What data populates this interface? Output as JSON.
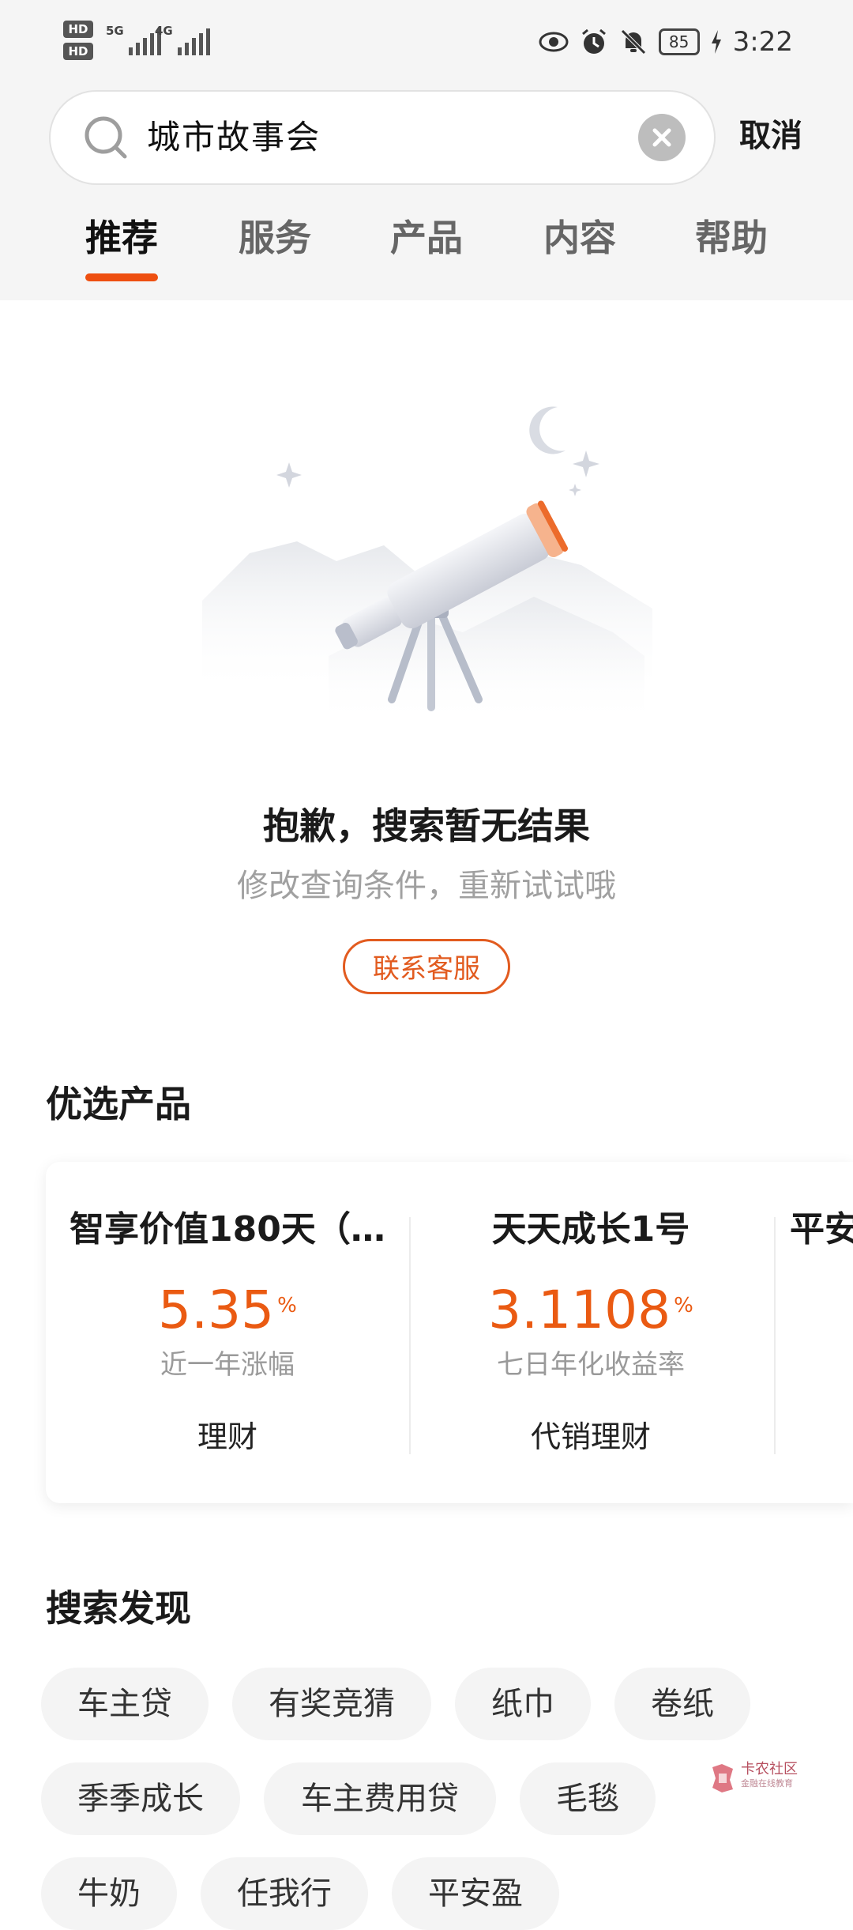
{
  "status_bar": {
    "time": "3:22",
    "battery": "85",
    "sim1": "HD",
    "sim2": "HD",
    "net1": "5G",
    "net2": "4G",
    "icons": [
      "eye-icon",
      "alarm-icon",
      "mute-bell-icon",
      "charging-icon"
    ]
  },
  "search": {
    "query": "城市故事会",
    "cancel_label": "取消"
  },
  "tabs": [
    {
      "label": "推荐",
      "active": true
    },
    {
      "label": "服务",
      "active": false
    },
    {
      "label": "产品",
      "active": false
    },
    {
      "label": "内容",
      "active": false
    },
    {
      "label": "帮助",
      "active": false
    }
  ],
  "empty_state": {
    "title": "抱歉，搜索暂无结果",
    "subtitle": "修改查询条件，重新试试哦",
    "contact_button": "联系客服"
  },
  "featured": {
    "title": "优选产品",
    "products": [
      {
        "name": "智享价值180天（…",
        "rate": "5.35",
        "unit": "%",
        "rate_label": "近一年涨幅",
        "type": "理财"
      },
      {
        "name": "天天成长1号",
        "rate": "3.1108",
        "unit": "%",
        "rate_label": "七日年化收益率",
        "type": "代销理财"
      },
      {
        "name": "平安"
      }
    ]
  },
  "discover": {
    "title": "搜索发现",
    "tags": [
      "车主贷",
      "有奖竞猜",
      "纸巾",
      "卷纸",
      "季季成长",
      "车主费用贷",
      "毛毯",
      "牛奶",
      "任我行",
      "平安盈"
    ]
  },
  "watermark": {
    "text": "卡农社区",
    "sub": "金融在线教育"
  },
  "colors": {
    "accent": "#ee4f10",
    "rate": "#ea5a12",
    "header_bg": "#f5f5f5",
    "tag_bg": "#f4f4f4"
  }
}
